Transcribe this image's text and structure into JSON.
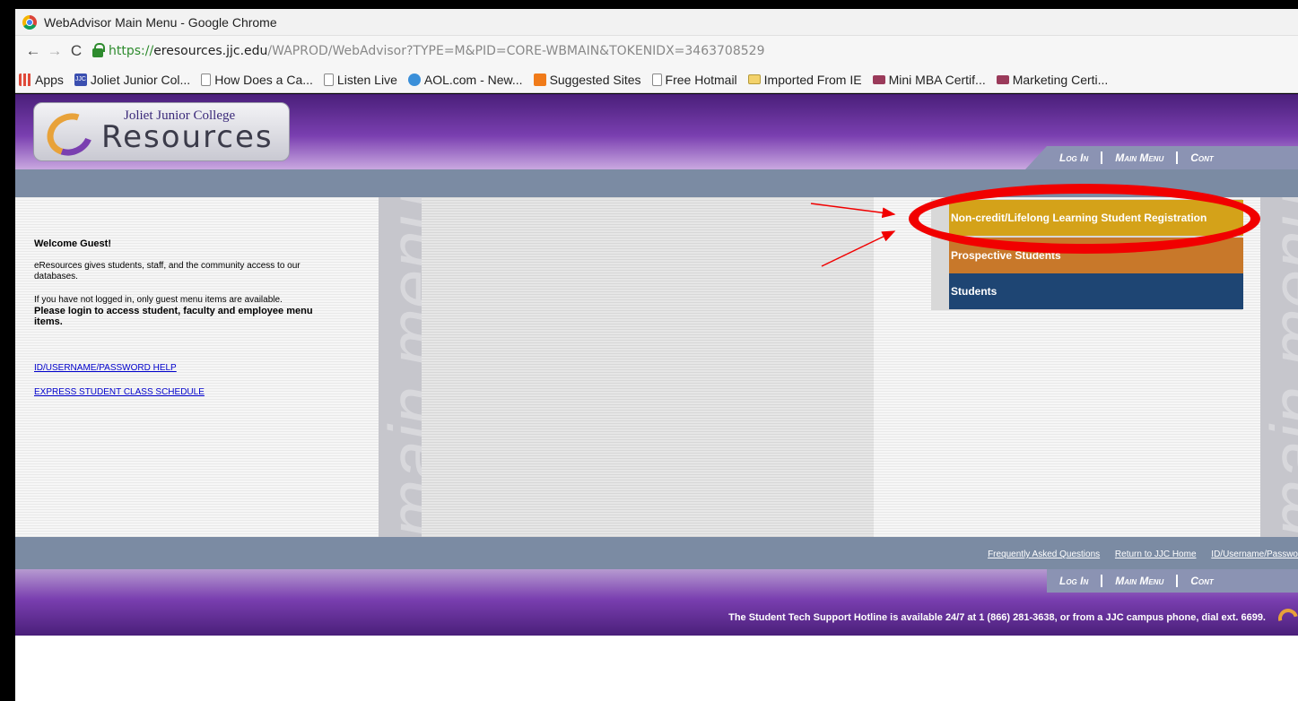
{
  "window": {
    "title": "WebAdvisor Main Menu - Google Chrome"
  },
  "address_bar": {
    "scheme": "https://",
    "host": "eresources.jjc.edu",
    "path": "/WAPROD/WebAdvisor?TYPE=M&PID=CORE-WBMAIN&TOKENIDX=3463708529"
  },
  "bookmarks": [
    {
      "label": "Apps",
      "icon": "apps-icon"
    },
    {
      "label": "Joliet Junior Col...",
      "icon": "jjc-icon"
    },
    {
      "label": "How Does a Ca...",
      "icon": "page-icon"
    },
    {
      "label": "Listen Live",
      "icon": "page-icon"
    },
    {
      "label": "AOL.com - New...",
      "icon": "aol-icon"
    },
    {
      "label": "Suggested Sites",
      "icon": "suggested-icon"
    },
    {
      "label": "Free Hotmail",
      "icon": "page-icon"
    },
    {
      "label": "Imported From IE",
      "icon": "folder-icon"
    },
    {
      "label": "Mini MBA Certif...",
      "icon": "iup-icon"
    },
    {
      "label": "Marketing Certi...",
      "icon": "iup-icon"
    }
  ],
  "logo": {
    "college": "Joliet Junior College",
    "product": "Resources"
  },
  "topnav": {
    "log_in": "Log In",
    "main_menu": "Main Menu",
    "contact": "Cont"
  },
  "left": {
    "welcome": "Welcome Guest!",
    "intro": "eResources gives students, staff, and the community access to our databases.",
    "guest_note": "If you have not logged in, only guest menu items are available.",
    "login_note": "Please login to access student, faculty and employee menu items.",
    "help_link": "ID/USERNAME/PASSWORD HELP",
    "schedule_link": "EXPRESS STUDENT CLASS SCHEDULE"
  },
  "watermark": "main menu",
  "menu": [
    {
      "label": "Non-credit/Lifelong Learning Student Registration",
      "color": "#d4a219"
    },
    {
      "label": "Prospective Students",
      "color": "#c8782a"
    },
    {
      "label": "Students",
      "color": "#1e4573"
    }
  ],
  "footer": {
    "faq": "Frequently Asked Questions",
    "return_home": "Return to JJC Home",
    "id_help": "ID/Username/Passwo",
    "hotline": "The Student Tech Support Hotline is available 24/7 at 1 (866) 281-3638, or from a JJC campus phone, dial ext. 6699."
  },
  "colors": {
    "purple": "#7a3fb0",
    "annotation": "#f10000"
  }
}
